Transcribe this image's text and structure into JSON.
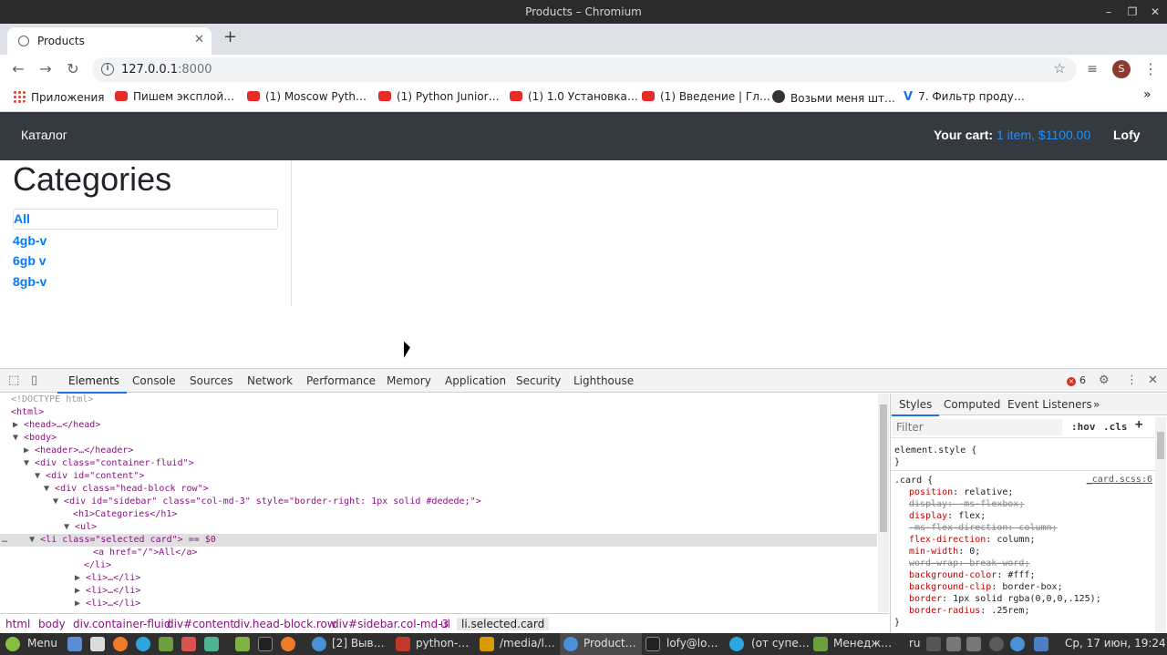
{
  "window": {
    "title": "Products – Chromium",
    "minimize": "–",
    "maximize": "❐",
    "close": "✕"
  },
  "tab": {
    "title": "Products",
    "close": "✕",
    "new_tab": "+"
  },
  "toolbar": {
    "back": "←",
    "forward": "→",
    "reload": "↻",
    "url_host": "127.0.0.1",
    "url_port": ":8000",
    "star": "☆",
    "media": "≡",
    "avatar": "S",
    "menu": "⋮"
  },
  "bookmarks": [
    {
      "label": "Приложения",
      "icon": "apps-grid-icon"
    },
    {
      "label": "Пишем эксплой…",
      "icon": "youtube-icon"
    },
    {
      "label": "(1) Moscow Pyth…",
      "icon": "youtube-icon"
    },
    {
      "label": "(1) Python Junior…",
      "icon": "youtube-icon"
    },
    {
      "label": "(1) 1.0 Установка…",
      "icon": "youtube-icon"
    },
    {
      "label": "(1) Введение | Гл…",
      "icon": "youtube-icon"
    },
    {
      "label": "Возьми меня шт…",
      "icon": "face-icon"
    },
    {
      "label": "7. Фильтр проду…",
      "icon": "v-icon"
    }
  ],
  "bookmarks_more": "»",
  "site": {
    "brand": "Каталог",
    "cart_label": "Your cart:",
    "cart_value": "1 item, $1100.00",
    "user": "Lofy",
    "heading": "Categories",
    "categories": [
      "All",
      "4gb-v",
      "6gb v",
      "8gb-v"
    ]
  },
  "devtools": {
    "tabs": [
      "Elements",
      "Console",
      "Sources",
      "Network",
      "Performance",
      "Memory",
      "Application",
      "Security",
      "Lighthouse"
    ],
    "error_count": "6",
    "dom_lines": [
      "<!DOCTYPE html>",
      "<html>",
      "<head>…</head>",
      "<body>",
      "<header>…</header>",
      "<div class=\"container-fluid\">",
      "<div id=\"content\">",
      "<div class=\"head-block row\">",
      "<div id=\"sidebar\" class=\"col-md-3\" style=\"border-right: 1px solid #dedede;\">",
      "<h1>Categories</h1>",
      "<ul>",
      "<li class=\"selected card\"> == $0",
      "<a href=\"/\">All</a>",
      "</li>",
      "<li>…</li>",
      "<li>…</li>",
      "<li>…</li>"
    ],
    "breadcrumbs": [
      "html",
      "body",
      "div.container-fluid",
      "div#content",
      "div.head-block.row",
      "div#sidebar.col-md-3",
      "ul",
      "li.selected.card"
    ],
    "styles_tabs": [
      "Styles",
      "Computed",
      "Event Listeners",
      "»"
    ],
    "filter_placeholder": "Filter",
    "hov": ":hov",
    "cls": ".cls",
    "plus": "+",
    "element_style": "element.style {",
    "close_brace": "}",
    "card_rule": ".card {",
    "card_source": "_card.scss:6",
    "declarations": [
      {
        "prop": "position",
        "value": "relative;",
        "struck": false
      },
      {
        "prop": "display",
        "value": "-ms-flexbox;",
        "struck": true
      },
      {
        "prop": "display",
        "value": "flex;",
        "struck": false
      },
      {
        "prop": "-ms-flex-direction",
        "value": "column;",
        "struck": true
      },
      {
        "prop": "flex-direction",
        "value": "column;",
        "struck": false
      },
      {
        "prop": "min-width",
        "value": "0;",
        "struck": false
      },
      {
        "prop": "word-wrap",
        "value": "break-word;",
        "struck": true
      },
      {
        "prop": "background-color",
        "value": "#fff;",
        "struck": false
      },
      {
        "prop": "background-clip",
        "value": "border-box;",
        "struck": false
      },
      {
        "prop": "border",
        "value": "1px solid rgba(0,0,0,.125);",
        "struck": false
      },
      {
        "prop": "border-radius",
        "value": ".25rem;",
        "struck": false
      }
    ]
  },
  "taskbar": {
    "menu": "Menu",
    "items": [
      "[2] Выв…",
      "python-…",
      "/media/l…",
      "Product…",
      "lofy@lo…",
      "(от супе…",
      "Менедж…"
    ],
    "lang": "ru",
    "clock": "Ср, 17 июн, 19:24"
  },
  "colors": {
    "navbar": "#343a40",
    "link": "#007bff",
    "cart_value": "#1e90ff",
    "accent": "#1a73e8"
  }
}
